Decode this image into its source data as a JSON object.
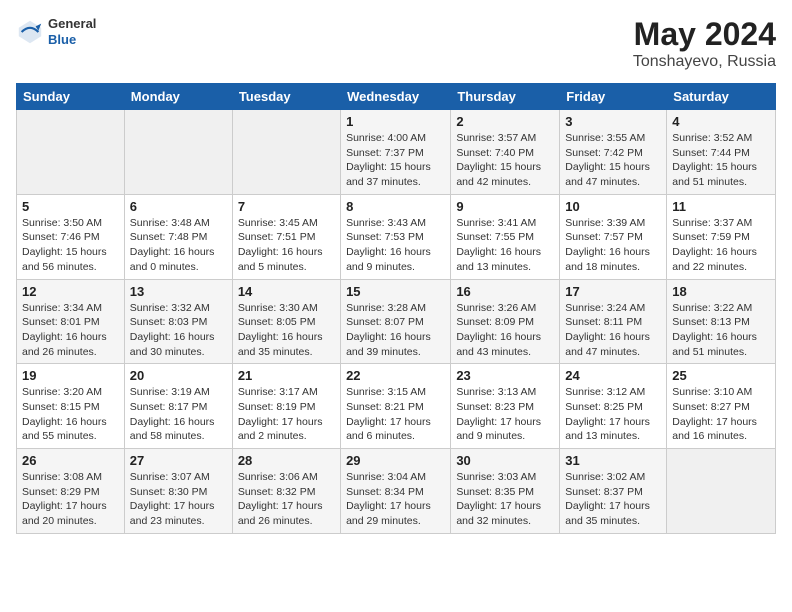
{
  "header": {
    "logo": {
      "general": "General",
      "blue": "Blue"
    },
    "title": "May 2024",
    "location": "Tonshayevo, Russia"
  },
  "weekdays": [
    "Sunday",
    "Monday",
    "Tuesday",
    "Wednesday",
    "Thursday",
    "Friday",
    "Saturday"
  ],
  "weeks": [
    [
      {
        "day": "",
        "info": ""
      },
      {
        "day": "",
        "info": ""
      },
      {
        "day": "",
        "info": ""
      },
      {
        "day": "1",
        "info": "Sunrise: 4:00 AM\nSunset: 7:37 PM\nDaylight: 15 hours\nand 37 minutes."
      },
      {
        "day": "2",
        "info": "Sunrise: 3:57 AM\nSunset: 7:40 PM\nDaylight: 15 hours\nand 42 minutes."
      },
      {
        "day": "3",
        "info": "Sunrise: 3:55 AM\nSunset: 7:42 PM\nDaylight: 15 hours\nand 47 minutes."
      },
      {
        "day": "4",
        "info": "Sunrise: 3:52 AM\nSunset: 7:44 PM\nDaylight: 15 hours\nand 51 minutes."
      }
    ],
    [
      {
        "day": "5",
        "info": "Sunrise: 3:50 AM\nSunset: 7:46 PM\nDaylight: 15 hours\nand 56 minutes."
      },
      {
        "day": "6",
        "info": "Sunrise: 3:48 AM\nSunset: 7:48 PM\nDaylight: 16 hours\nand 0 minutes."
      },
      {
        "day": "7",
        "info": "Sunrise: 3:45 AM\nSunset: 7:51 PM\nDaylight: 16 hours\nand 5 minutes."
      },
      {
        "day": "8",
        "info": "Sunrise: 3:43 AM\nSunset: 7:53 PM\nDaylight: 16 hours\nand 9 minutes."
      },
      {
        "day": "9",
        "info": "Sunrise: 3:41 AM\nSunset: 7:55 PM\nDaylight: 16 hours\nand 13 minutes."
      },
      {
        "day": "10",
        "info": "Sunrise: 3:39 AM\nSunset: 7:57 PM\nDaylight: 16 hours\nand 18 minutes."
      },
      {
        "day": "11",
        "info": "Sunrise: 3:37 AM\nSunset: 7:59 PM\nDaylight: 16 hours\nand 22 minutes."
      }
    ],
    [
      {
        "day": "12",
        "info": "Sunrise: 3:34 AM\nSunset: 8:01 PM\nDaylight: 16 hours\nand 26 minutes."
      },
      {
        "day": "13",
        "info": "Sunrise: 3:32 AM\nSunset: 8:03 PM\nDaylight: 16 hours\nand 30 minutes."
      },
      {
        "day": "14",
        "info": "Sunrise: 3:30 AM\nSunset: 8:05 PM\nDaylight: 16 hours\nand 35 minutes."
      },
      {
        "day": "15",
        "info": "Sunrise: 3:28 AM\nSunset: 8:07 PM\nDaylight: 16 hours\nand 39 minutes."
      },
      {
        "day": "16",
        "info": "Sunrise: 3:26 AM\nSunset: 8:09 PM\nDaylight: 16 hours\nand 43 minutes."
      },
      {
        "day": "17",
        "info": "Sunrise: 3:24 AM\nSunset: 8:11 PM\nDaylight: 16 hours\nand 47 minutes."
      },
      {
        "day": "18",
        "info": "Sunrise: 3:22 AM\nSunset: 8:13 PM\nDaylight: 16 hours\nand 51 minutes."
      }
    ],
    [
      {
        "day": "19",
        "info": "Sunrise: 3:20 AM\nSunset: 8:15 PM\nDaylight: 16 hours\nand 55 minutes."
      },
      {
        "day": "20",
        "info": "Sunrise: 3:19 AM\nSunset: 8:17 PM\nDaylight: 16 hours\nand 58 minutes."
      },
      {
        "day": "21",
        "info": "Sunrise: 3:17 AM\nSunset: 8:19 PM\nDaylight: 17 hours\nand 2 minutes."
      },
      {
        "day": "22",
        "info": "Sunrise: 3:15 AM\nSunset: 8:21 PM\nDaylight: 17 hours\nand 6 minutes."
      },
      {
        "day": "23",
        "info": "Sunrise: 3:13 AM\nSunset: 8:23 PM\nDaylight: 17 hours\nand 9 minutes."
      },
      {
        "day": "24",
        "info": "Sunrise: 3:12 AM\nSunset: 8:25 PM\nDaylight: 17 hours\nand 13 minutes."
      },
      {
        "day": "25",
        "info": "Sunrise: 3:10 AM\nSunset: 8:27 PM\nDaylight: 17 hours\nand 16 minutes."
      }
    ],
    [
      {
        "day": "26",
        "info": "Sunrise: 3:08 AM\nSunset: 8:29 PM\nDaylight: 17 hours\nand 20 minutes."
      },
      {
        "day": "27",
        "info": "Sunrise: 3:07 AM\nSunset: 8:30 PM\nDaylight: 17 hours\nand 23 minutes."
      },
      {
        "day": "28",
        "info": "Sunrise: 3:06 AM\nSunset: 8:32 PM\nDaylight: 17 hours\nand 26 minutes."
      },
      {
        "day": "29",
        "info": "Sunrise: 3:04 AM\nSunset: 8:34 PM\nDaylight: 17 hours\nand 29 minutes."
      },
      {
        "day": "30",
        "info": "Sunrise: 3:03 AM\nSunset: 8:35 PM\nDaylight: 17 hours\nand 32 minutes."
      },
      {
        "day": "31",
        "info": "Sunrise: 3:02 AM\nSunset: 8:37 PM\nDaylight: 17 hours\nand 35 minutes."
      },
      {
        "day": "",
        "info": ""
      }
    ]
  ]
}
